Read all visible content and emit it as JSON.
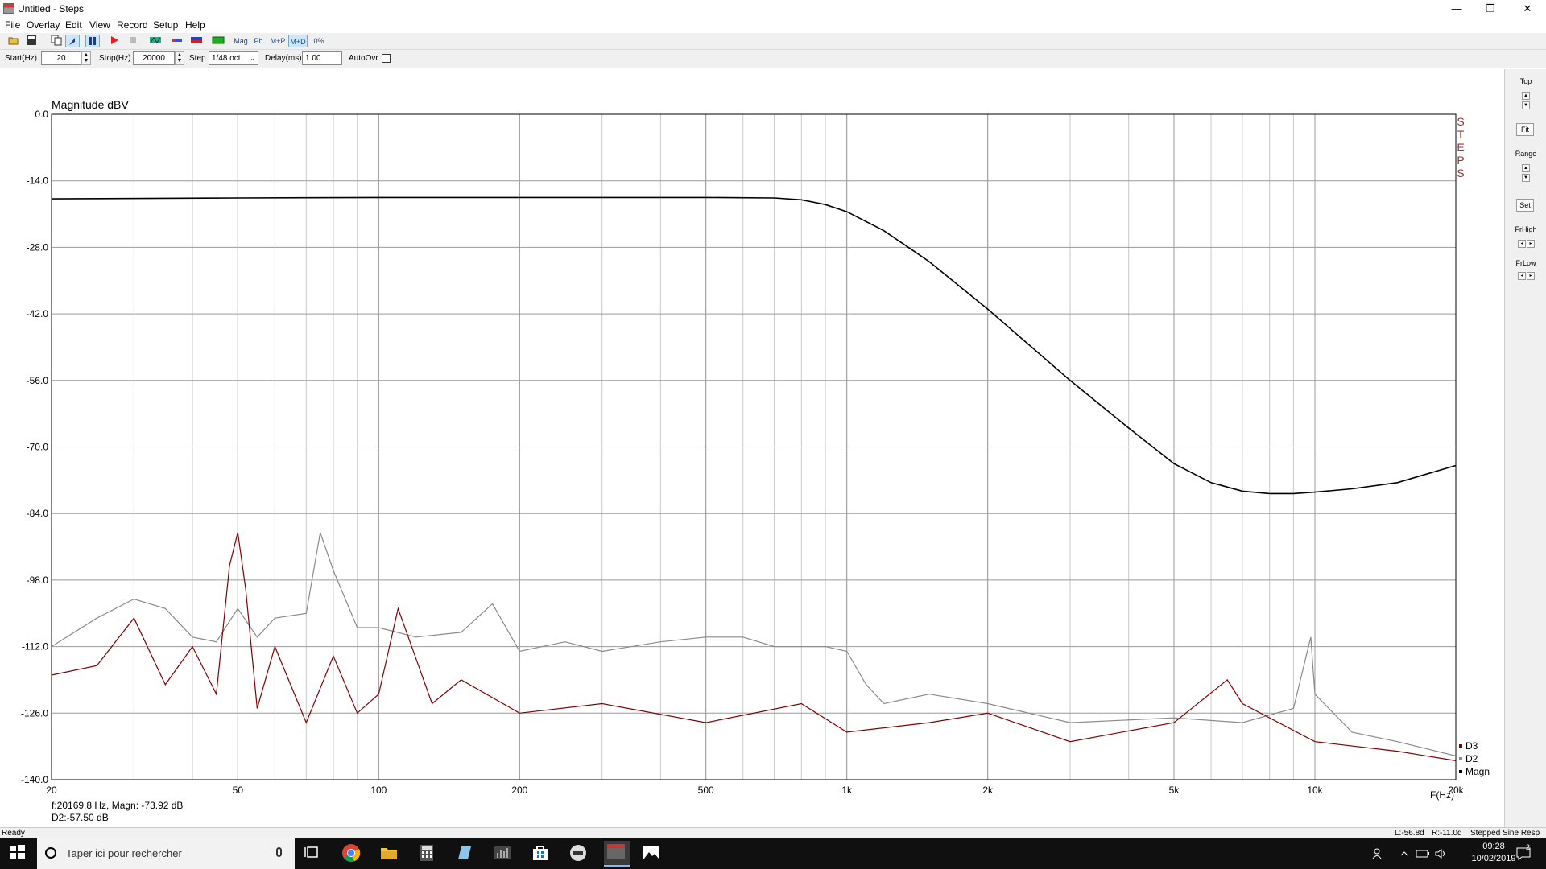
{
  "window": {
    "title": "Untitled - Steps",
    "minimize_glyph": "—",
    "restore_glyph": "❐",
    "close_glyph": "✕"
  },
  "menu": [
    "File",
    "Overlay",
    "Edit",
    "View",
    "Record",
    "Setup",
    "Help"
  ],
  "toolbar": {
    "buttons": [
      "open-icon",
      "save-icon",
      "copy-icon",
      "pointer-icon",
      "pause-icon",
      "record-icon",
      "stop-icon",
      "pattern-icon",
      "link-icon",
      "flag-icon",
      "screen-icon"
    ],
    "mode_labels": [
      "Mag",
      "Ph",
      "M+P",
      "M+D",
      "0%"
    ]
  },
  "params": {
    "start_label": "Start(Hz)",
    "start_value": "20",
    "stop_label": "Stop(Hz)",
    "stop_value": "20000",
    "step_label": "Step",
    "step_value": "1/48 oct.",
    "delay_label": "Delay(ms)",
    "delay_value": "1.00",
    "autoovr_label": "AutoOvr"
  },
  "right_panel": {
    "top_label": "Top",
    "fit_label": "Fit",
    "range_label": "Range",
    "set_label": "Set",
    "frhigh_label": "FrHigh",
    "frlow_label": "FrLow"
  },
  "chart_data": {
    "type": "line",
    "title": "Magnitude dBV",
    "xlabel": "F(Hz)",
    "ylabel": "Magnitude dBV",
    "x_scale": "log",
    "xlim": [
      20,
      20000
    ],
    "ylim": [
      -140,
      0
    ],
    "x_ticks": [
      "20",
      "50",
      "100",
      "200",
      "500",
      "1k",
      "2k",
      "5k",
      "10k",
      "20k"
    ],
    "y_ticks": [
      "0.0",
      "-14.0",
      "-28.0",
      "-42.0",
      "-56.0",
      "-70.0",
      "-84.0",
      "-98.0",
      "-112.0",
      "-126.0",
      "-140.0"
    ],
    "grid": true,
    "watermark": "STEPS",
    "legend_position": "bottom-right",
    "series": [
      {
        "name": "Magn",
        "color": "#000000",
        "x": [
          20,
          50,
          100,
          200,
          500,
          700,
          800,
          900,
          1000,
          1200,
          1500,
          2000,
          3000,
          4000,
          5000,
          6000,
          7000,
          8000,
          9000,
          10000,
          12000,
          15000,
          20000
        ],
        "y": [
          -17.8,
          -17.6,
          -17.5,
          -17.5,
          -17.5,
          -17.6,
          -18.0,
          -19.0,
          -20.5,
          -24.5,
          -31.0,
          -41.0,
          -56.0,
          -66.0,
          -73.5,
          -77.5,
          -79.3,
          -79.8,
          -79.8,
          -79.5,
          -78.8,
          -77.5,
          -73.9
        ]
      },
      {
        "name": "D2",
        "color": "#8a8a8a",
        "x": [
          20,
          25,
          30,
          35,
          40,
          45,
          50,
          55,
          60,
          70,
          75,
          80,
          90,
          100,
          120,
          150,
          175,
          200,
          250,
          300,
          400,
          500,
          600,
          700,
          800,
          900,
          1000,
          1100,
          1200,
          1500,
          2000,
          3000,
          5000,
          7000,
          9000,
          9800,
          10000,
          12000,
          15000,
          20000
        ],
        "y": [
          -112,
          -106,
          -102,
          -104,
          -110,
          -111,
          -104,
          -110,
          -106,
          -105,
          -88,
          -96,
          -108,
          -108,
          -110,
          -109,
          -103,
          -113,
          -111,
          -113,
          -111,
          -110,
          -110,
          -112,
          -112,
          -112,
          -113,
          -120,
          -124,
          -122,
          -124,
          -128,
          -127,
          -128,
          -125,
          -110,
          -122,
          -130,
          -132,
          -135
        ]
      },
      {
        "name": "D3",
        "color": "#800000",
        "x": [
          20,
          25,
          30,
          35,
          40,
          45,
          48,
          50,
          52,
          55,
          60,
          70,
          80,
          90,
          100,
          110,
          130,
          150,
          200,
          300,
          500,
          800,
          1000,
          1500,
          2000,
          3000,
          5000,
          6500,
          7000,
          10000,
          15000,
          20000
        ],
        "y": [
          -118,
          -116,
          -106,
          -120,
          -112,
          -122,
          -95,
          -88,
          -100,
          -125,
          -112,
          -128,
          -114,
          -126,
          -122,
          -104,
          -124,
          -119,
          -126,
          -124,
          -128,
          -124,
          -130,
          -128,
          -126,
          -132,
          -128,
          -119,
          -124,
          -132,
          -134,
          -136
        ]
      }
    ],
    "cursor_readout_1": "f:20169.8 Hz, Magn: -73.92 dB",
    "cursor_readout_2": "D2:-57.50 dB"
  },
  "status": {
    "left": "Ready",
    "levels": "L:-56.8d",
    "right_level": "R:-11.0d",
    "mode": "Stepped Sine Resp"
  },
  "taskbar": {
    "search_placeholder": "Taper ici pour rechercher",
    "time": "09:28",
    "date": "10/02/2019",
    "notification_count": "2"
  }
}
